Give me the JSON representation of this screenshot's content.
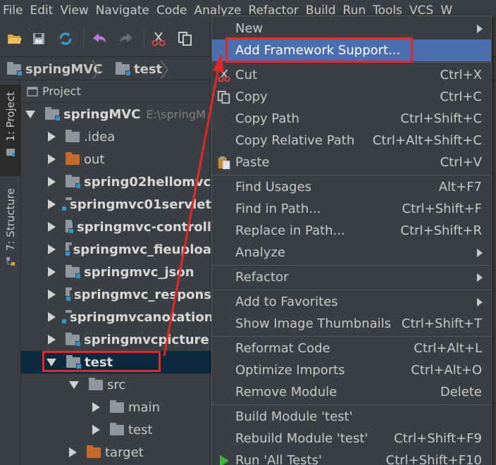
{
  "menubar": {
    "items": [
      "File",
      "Edit",
      "View",
      "Navigate",
      "Code",
      "Analyze",
      "Refactor",
      "Build",
      "Run",
      "Tools",
      "VCS",
      "W"
    ]
  },
  "toolbar": {
    "icons": [
      "open-folder-icon",
      "save-icon",
      "sync-icon",
      "undo-icon",
      "redo-icon",
      "cut-icon",
      "copy-icon"
    ]
  },
  "breadcrumb": {
    "items": [
      "springMVC",
      "test"
    ]
  },
  "sidebar": {
    "project_tab": "1: Project",
    "structure_tab": "7: Structure"
  },
  "project_panel": {
    "title": "Project"
  },
  "tree": {
    "root": {
      "name": "springMVC",
      "path": "E:\\springM"
    },
    "items": [
      {
        "name": ".idea"
      },
      {
        "name": "out"
      },
      {
        "name": "spring02hellomvc"
      },
      {
        "name": "springmvc01servlet"
      },
      {
        "name": "springmvc-controll"
      },
      {
        "name": "springmvc_fieuploa"
      },
      {
        "name": "springmvc_json"
      },
      {
        "name": "springmvc_respons"
      },
      {
        "name": "springmvcanotation"
      },
      {
        "name": "springmvcpicture"
      },
      {
        "name": "test"
      },
      {
        "name": "src"
      },
      {
        "name": "main"
      },
      {
        "name": "test"
      },
      {
        "name": "target"
      }
    ]
  },
  "context_menu": {
    "items": [
      {
        "label": "New",
        "shortcut": ""
      },
      {
        "label": "Add Framework Support...",
        "shortcut": ""
      },
      {
        "label": "Cut",
        "shortcut": "Ctrl+X"
      },
      {
        "label": "Copy",
        "shortcut": "Ctrl+C"
      },
      {
        "label": "Copy Path",
        "shortcut": "Ctrl+Shift+C"
      },
      {
        "label": "Copy Relative Path",
        "shortcut": "Ctrl+Alt+Shift+C"
      },
      {
        "label": "Paste",
        "shortcut": "Ctrl+V"
      },
      {
        "label": "Find Usages",
        "shortcut": "Alt+F7"
      },
      {
        "label": "Find in Path...",
        "shortcut": "Ctrl+Shift+F"
      },
      {
        "label": "Replace in Path...",
        "shortcut": "Ctrl+Shift+R"
      },
      {
        "label": "Analyze",
        "shortcut": ""
      },
      {
        "label": "Refactor",
        "shortcut": ""
      },
      {
        "label": "Add to Favorites",
        "shortcut": ""
      },
      {
        "label": "Show Image Thumbnails",
        "shortcut": "Ctrl+Shift+T"
      },
      {
        "label": "Reformat Code",
        "shortcut": "Ctrl+Alt+L"
      },
      {
        "label": "Optimize Imports",
        "shortcut": "Ctrl+Alt+O"
      },
      {
        "label": "Remove Module",
        "shortcut": "Delete"
      },
      {
        "label": "Build Module 'test'",
        "shortcut": ""
      },
      {
        "label": "Rebuild Module 'test'",
        "shortcut": "Ctrl+Shift+F9"
      },
      {
        "label": "Run 'All Tests'",
        "shortcut": "Ctrl+Shift+F10"
      }
    ]
  },
  "colors": {
    "background": "#3c3f41",
    "selection": "#0d293e",
    "highlight": "#4b6eaf",
    "annotation": "#e0292b",
    "run_icon": "#3fb83f"
  }
}
